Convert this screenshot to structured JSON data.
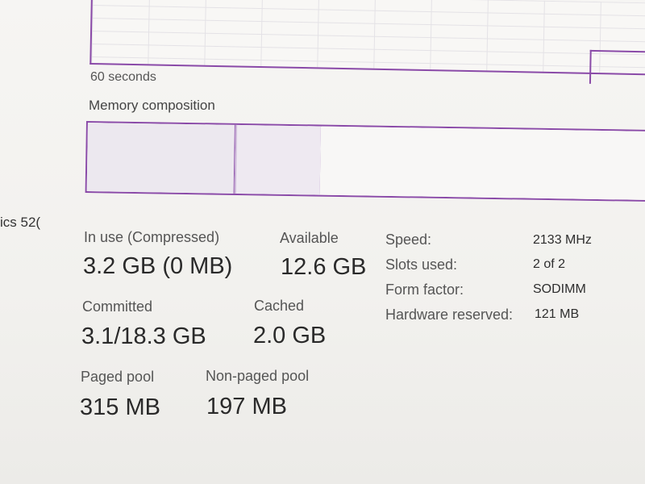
{
  "graph": {
    "time_label": "60 seconds"
  },
  "composition": {
    "title": "Memory composition"
  },
  "sidebar": {
    "partial_label": "ics 52("
  },
  "stats": {
    "in_use_label": "In use (Compressed)",
    "in_use_value": "3.2 GB (0 MB)",
    "available_label": "Available",
    "available_value": "12.6 GB",
    "committed_label": "Committed",
    "committed_value": "3.1/18.3 GB",
    "cached_label": "Cached",
    "cached_value": "2.0 GB",
    "paged_pool_label": "Paged pool",
    "paged_pool_value": "315 MB",
    "non_paged_pool_label": "Non-paged pool",
    "non_paged_pool_value": "197 MB"
  },
  "properties": [
    {
      "label": "Speed:",
      "value": "2133 MHz"
    },
    {
      "label": "Slots used:",
      "value": "2 of 2"
    },
    {
      "label": "Form factor:",
      "value": "SODIMM"
    },
    {
      "label": "Hardware reserved:",
      "value": "121 MB"
    }
  ],
  "colors": {
    "accent": "#8a4aa8",
    "background": "#f4f3f0"
  }
}
